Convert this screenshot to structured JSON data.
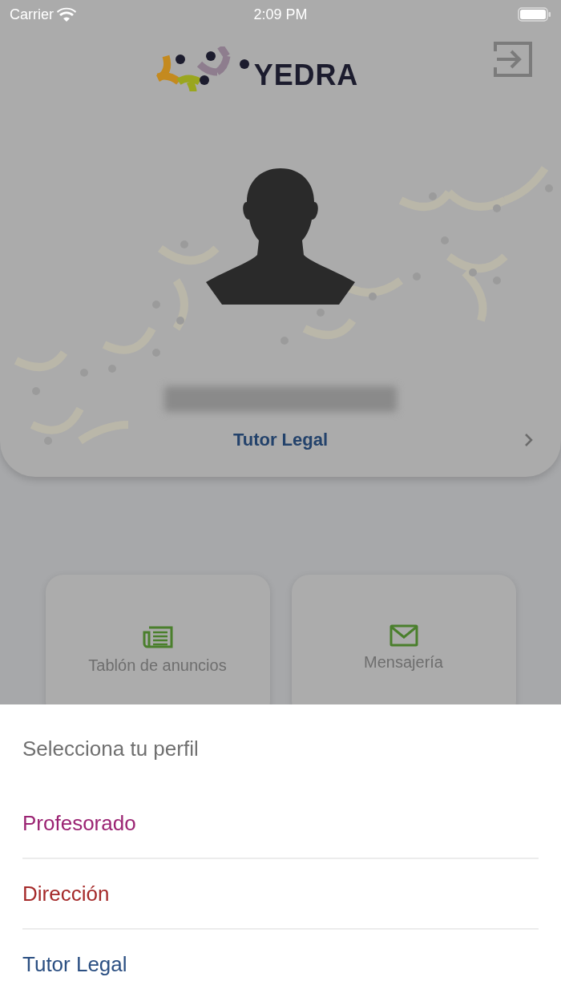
{
  "status_bar": {
    "carrier": "Carrier",
    "time": "2:09 PM"
  },
  "header": {
    "logo_text": "YEDRA"
  },
  "profile": {
    "role": "Tutor Legal"
  },
  "tiles": [
    {
      "kind": "news",
      "label": "Tablón de anuncios"
    },
    {
      "kind": "mail",
      "label": "Mensajería"
    }
  ],
  "sheet": {
    "title": "Selecciona tu perfil",
    "options": [
      {
        "label": "Profesorado",
        "color": "#9b2473"
      },
      {
        "label": "Dirección",
        "color": "#a52a2a"
      },
      {
        "label": "Tutor Legal",
        "color": "#2b4f82"
      }
    ]
  }
}
